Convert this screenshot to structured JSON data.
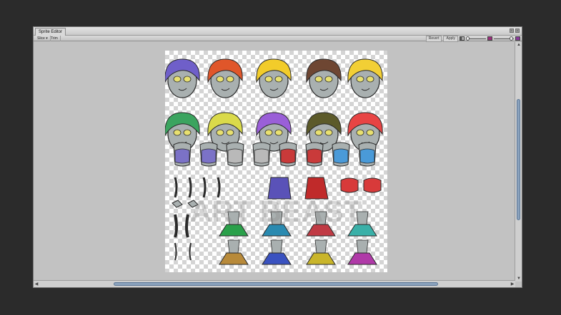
{
  "window": {
    "tab_title": "Sprite Editor",
    "controls": [
      "▪",
      "×"
    ]
  },
  "toolbar": {
    "slice_label": "Slice ▾",
    "trim_label": "Trim",
    "revert_label": "Revert",
    "apply_label": "Apply",
    "channel_icon": "rgb-alpha-toggle-icon",
    "zoom_icon": "mip-level-icon"
  },
  "scrollbars": {
    "up": "▲",
    "down": "▼",
    "left": "◀",
    "right": "▶"
  },
  "sprite_sheet": {
    "watermark": "ART BEAST",
    "heads": [
      {
        "hair": "#6f5fc9"
      },
      {
        "hair": "#e0562a"
      },
      {
        "hair": "#f2cc2a"
      },
      {
        "hair": "#6e4632"
      },
      {
        "hair": "#f2cf35"
      },
      {
        "hair": "#3ba45f"
      },
      {
        "hair": "#dada4a"
      },
      {
        "hair": "#9a5fd8"
      },
      {
        "hair": "#5c5a2a"
      },
      {
        "hair": "#e84444"
      }
    ],
    "torsos": [
      "#7b72c7",
      "#7b72c7",
      "#b9b9b9",
      "#b9b9b9",
      "#c93a3a",
      "#c93a3a",
      "#4a9ad8",
      "#4a9ad8"
    ],
    "skirts_row1": [
      "#2aa04a",
      "#2a8ab0",
      "#c03a44",
      "#3ab0a8"
    ],
    "skirts_row2": [
      "#b88a3a",
      "#3a52c0",
      "#c9b52a",
      "#b03aa8"
    ],
    "accent": {
      "titlebar": "#d6d6d6",
      "scroll_thumb": "#8aa2bd",
      "background": "#2b2b2b"
    }
  }
}
